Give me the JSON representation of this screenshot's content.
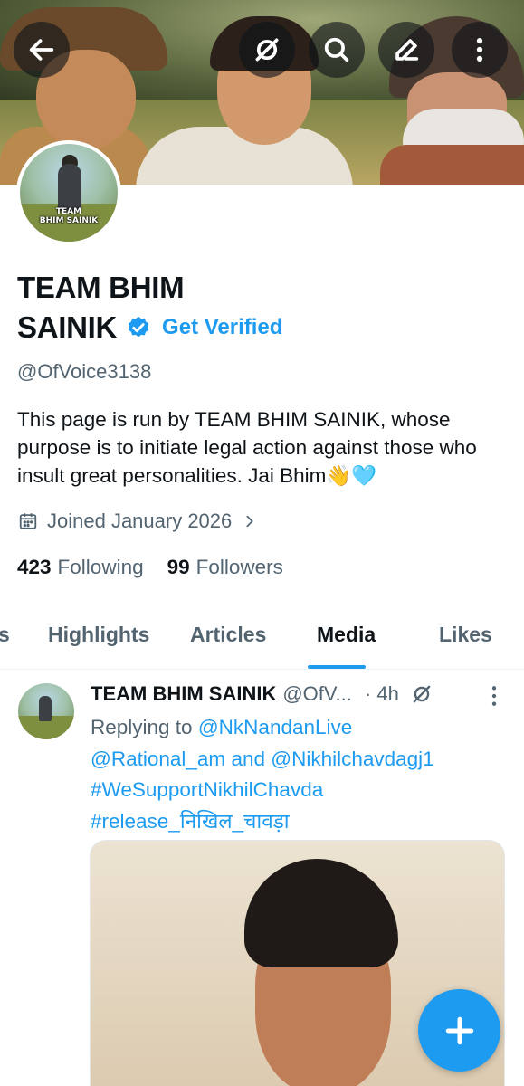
{
  "profile": {
    "name_line1": "TEAM BHIM",
    "name_line2": "SAINIK",
    "get_verified": "Get Verified",
    "handle": "@OfVoice3138",
    "bio": "This page is run by TEAM BHIM SAINIK, whose purpose is to initiate legal action against those who insult great personalities.  Jai Bhim👋🩵",
    "joined": "Joined January 2026",
    "avatar_text_line1": "TEAM",
    "avatar_text_line2": "BHIM SAINIK",
    "following_count": "423",
    "following_label": "Following",
    "followers_count": "99",
    "followers_label": "Followers"
  },
  "header": {
    "icons": [
      "back-arrow-icon",
      "grok-icon",
      "search-icon",
      "edit-icon",
      "more-vertical-icon"
    ]
  },
  "tabs": [
    {
      "label": "s"
    },
    {
      "label": "Highlights"
    },
    {
      "label": "Articles"
    },
    {
      "label": "Media",
      "active": true
    },
    {
      "label": "Likes"
    }
  ],
  "post": {
    "author": "TEAM BHIM SAINIK",
    "handle": "@OfV...",
    "time": "· 4h",
    "replying_prefix": "Replying to",
    "reply_to_1": "@NkNandanLive",
    "reply_to_2": "@Rational_am",
    "and": "and",
    "reply_to_3": "@Nikhilchavdagj1",
    "hashtag_1": "#WeSupportNikhilChavda",
    "hashtag_2": "#release_निखिल_चावड़ा"
  },
  "colors": {
    "accent": "#1d9bf0",
    "text_primary": "#0f1419",
    "text_secondary": "#536471"
  }
}
